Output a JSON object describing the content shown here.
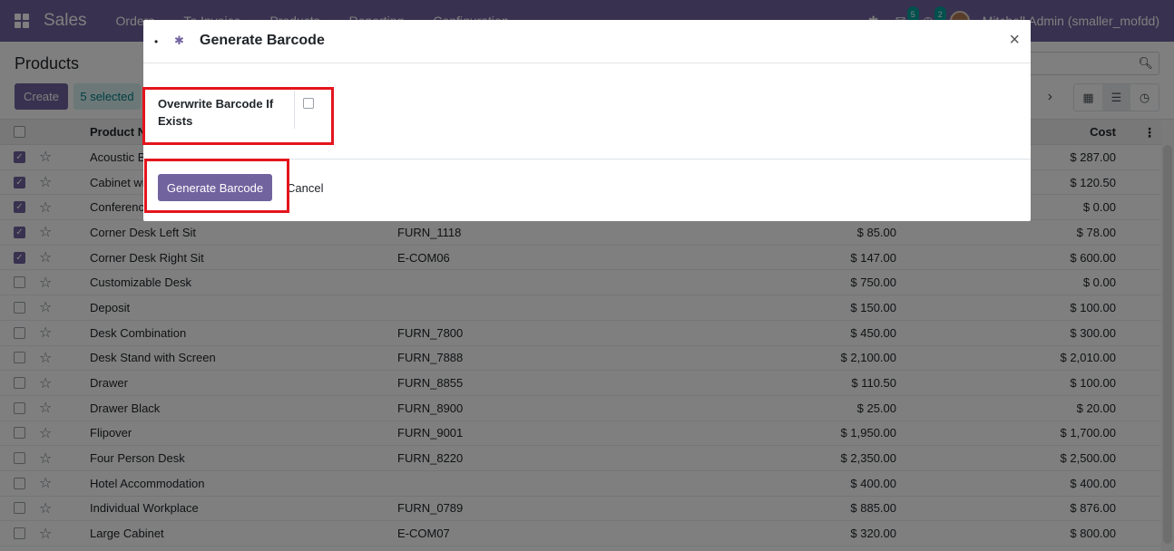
{
  "navbar": {
    "brand": "Sales",
    "menus": [
      "Orders",
      "To Invoice",
      "Products",
      "Reporting",
      "Configuration"
    ],
    "chat_count": "5",
    "activity_count": "2",
    "user": "Mitchell Admin (smaller_mofdd)"
  },
  "control_panel": {
    "title": "Products",
    "create_label": "Create",
    "selected_label": "5 selected"
  },
  "table": {
    "headers": {
      "name": "Product Name",
      "cost": "Cost"
    },
    "rows": [
      {
        "checked": true,
        "name": "Acoustic Bloc Screens",
        "ref": "",
        "price": "",
        "cost": "$ 287.00"
      },
      {
        "checked": true,
        "name": "Cabinet with Doors",
        "ref": "",
        "price": "",
        "cost": "$ 120.50"
      },
      {
        "checked": true,
        "name": "Conference Chair",
        "ref": "",
        "price": "",
        "cost": "$ 0.00"
      },
      {
        "checked": true,
        "name": "Corner Desk Left Sit",
        "ref": "FURN_1118",
        "price": "$ 85.00",
        "cost": "$ 78.00"
      },
      {
        "checked": true,
        "name": "Corner Desk Right Sit",
        "ref": "E-COM06",
        "price": "$ 147.00",
        "cost": "$ 600.00"
      },
      {
        "checked": false,
        "name": "Customizable Desk",
        "ref": "",
        "price": "$ 750.00",
        "cost": "$ 0.00"
      },
      {
        "checked": false,
        "name": "Deposit",
        "ref": "",
        "price": "$ 150.00",
        "cost": "$ 100.00"
      },
      {
        "checked": false,
        "name": "Desk Combination",
        "ref": "FURN_7800",
        "price": "$ 450.00",
        "cost": "$ 300.00"
      },
      {
        "checked": false,
        "name": "Desk Stand with Screen",
        "ref": "FURN_7888",
        "price": "$ 2,100.00",
        "cost": "$ 2,010.00"
      },
      {
        "checked": false,
        "name": "Drawer",
        "ref": "FURN_8855",
        "price": "$ 110.50",
        "cost": "$ 100.00"
      },
      {
        "checked": false,
        "name": "Drawer Black",
        "ref": "FURN_8900",
        "price": "$ 25.00",
        "cost": "$ 20.00"
      },
      {
        "checked": false,
        "name": "Flipover",
        "ref": "FURN_9001",
        "price": "$ 1,950.00",
        "cost": "$ 1,700.00"
      },
      {
        "checked": false,
        "name": "Four Person Desk",
        "ref": "FURN_8220",
        "price": "$ 2,350.00",
        "cost": "$ 2,500.00"
      },
      {
        "checked": false,
        "name": "Hotel Accommodation",
        "ref": "",
        "price": "$ 400.00",
        "cost": "$ 400.00"
      },
      {
        "checked": false,
        "name": "Individual Workplace",
        "ref": "FURN_0789",
        "price": "$ 885.00",
        "cost": "$ 876.00"
      },
      {
        "checked": false,
        "name": "Large Cabinet",
        "ref": "E-COM07",
        "price": "$ 320.00",
        "cost": "$ 800.00"
      }
    ]
  },
  "modal": {
    "title": "Generate Barcode",
    "field_label": "Overwrite Barcode If Exists",
    "primary_label": "Generate Barcode",
    "cancel_label": "Cancel"
  },
  "colors": {
    "brand": "#71639e",
    "highlight": "#e4151c"
  }
}
